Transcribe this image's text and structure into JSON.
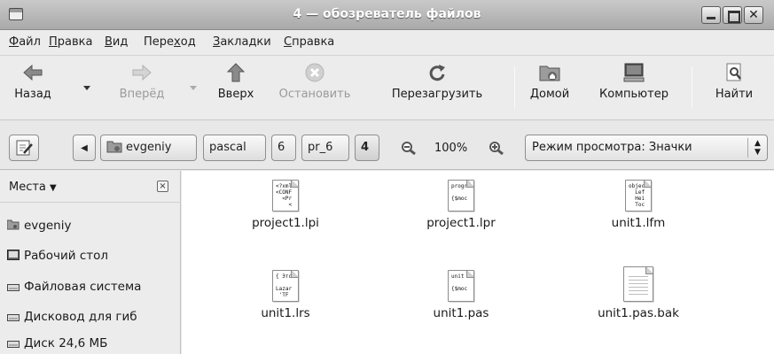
{
  "window": {
    "title": "4 — обозреватель файлов"
  },
  "menu": [
    {
      "label": "Файл",
      "mnemonic": "Ф",
      "rest": "айл"
    },
    {
      "label": "Правка",
      "mnemonic": "П",
      "rest": "равка"
    },
    {
      "label": "Вид",
      "mnemonic": "В",
      "rest": "ид"
    },
    {
      "label": "Переход",
      "pre": "Пере",
      "mnemonic": "х",
      "rest": "од"
    },
    {
      "label": "Закладки",
      "mnemonic": "З",
      "rest": "акладки"
    },
    {
      "label": "Справка",
      "mnemonic": "С",
      "rest": "правка"
    }
  ],
  "toolbar": {
    "back": "Назад",
    "forward": "Вперёд",
    "up": "Вверх",
    "stop": "Остановить",
    "reload": "Перезагрузить",
    "home": "Домой",
    "computer": "Компьютер",
    "search": "Найти"
  },
  "location": {
    "path": [
      "evgeniy",
      "pascal",
      "6",
      "pr_6",
      "4"
    ],
    "zoom": "100%",
    "view_mode": "Режим просмотра: Значки"
  },
  "sidebar": {
    "title": "Места",
    "close_glyph": "⊠",
    "items": [
      {
        "label": "evgeniy",
        "icon": "home-folder-icon"
      },
      {
        "label": "Рабочий стол",
        "icon": "desktop-icon"
      },
      {
        "label": "Файловая система",
        "icon": "drive-icon"
      },
      {
        "label": "Дисковод для гиб",
        "icon": "drive-icon"
      },
      {
        "label": "Диск 24,6 МБ",
        "icon": "drive-icon"
      }
    ]
  },
  "files": [
    {
      "name": "project1.lpi",
      "preview": "<?xml\n<CONF\n  <Pr\n    <"
    },
    {
      "name": "project1.lpr",
      "preview": "progr\n\n{$moc"
    },
    {
      "name": "unit1.lfm",
      "preview": "objec\n  Lef\n  Hei\n  Toc"
    },
    {
      "name": "unit1.lrs",
      "preview": "{ Это\n\nLazar\n 'TF"
    },
    {
      "name": "unit1.pas",
      "preview": "unit\n\n{$moc"
    },
    {
      "name": "unit1.pas.bak",
      "preview": ""
    }
  ]
}
